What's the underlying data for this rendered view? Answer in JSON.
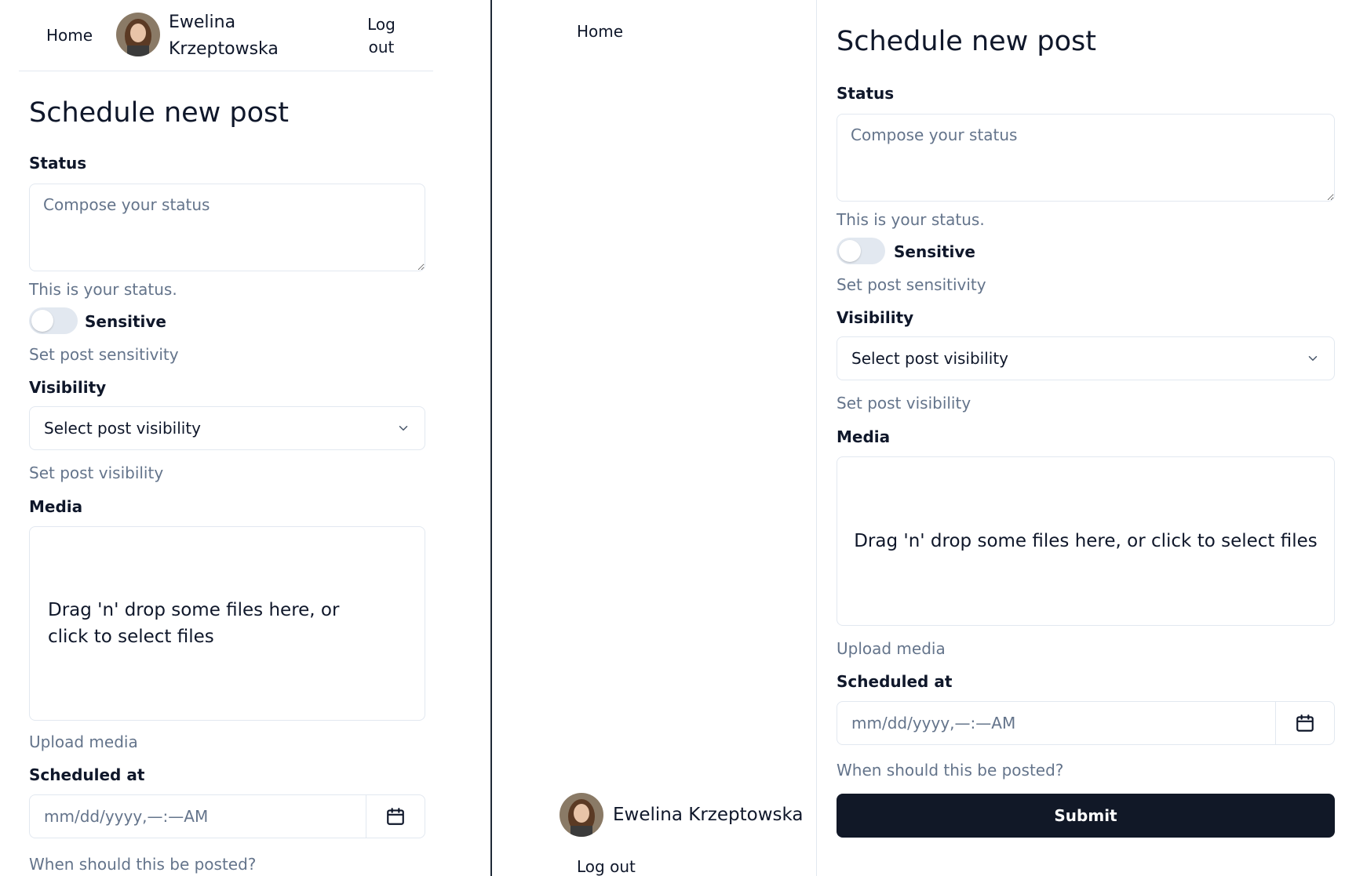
{
  "nav": {
    "home_label": "Home",
    "logout_label": "Log out",
    "user_name": "Ewelina Krzeptowska"
  },
  "form": {
    "title": "Schedule new post",
    "status": {
      "label": "Status",
      "placeholder": "Compose your status",
      "hint": "This is your status."
    },
    "sensitive": {
      "label": "Sensitive",
      "checked": false,
      "hint": "Set post sensitivity"
    },
    "visibility": {
      "label": "Visibility",
      "selected": "Select post visibility",
      "hint": "Set post visibility"
    },
    "media": {
      "label": "Media",
      "dropzone_text": "Drag 'n' drop some files here, or click to select files",
      "hint": "Upload media"
    },
    "scheduled_at": {
      "label": "Scheduled at",
      "placeholder": "mm/dd/yyyy,—:—AM",
      "hint": "When should this be posted?"
    },
    "submit_label": "Submit"
  },
  "colors": {
    "primary": "#111827",
    "muted_text": "#64748b",
    "border": "#e2e8f0",
    "divider": "#1f2937"
  },
  "icons": {
    "calendar": "calendar-icon",
    "chevron": "chevron-down-icon",
    "avatar": "user-avatar"
  }
}
